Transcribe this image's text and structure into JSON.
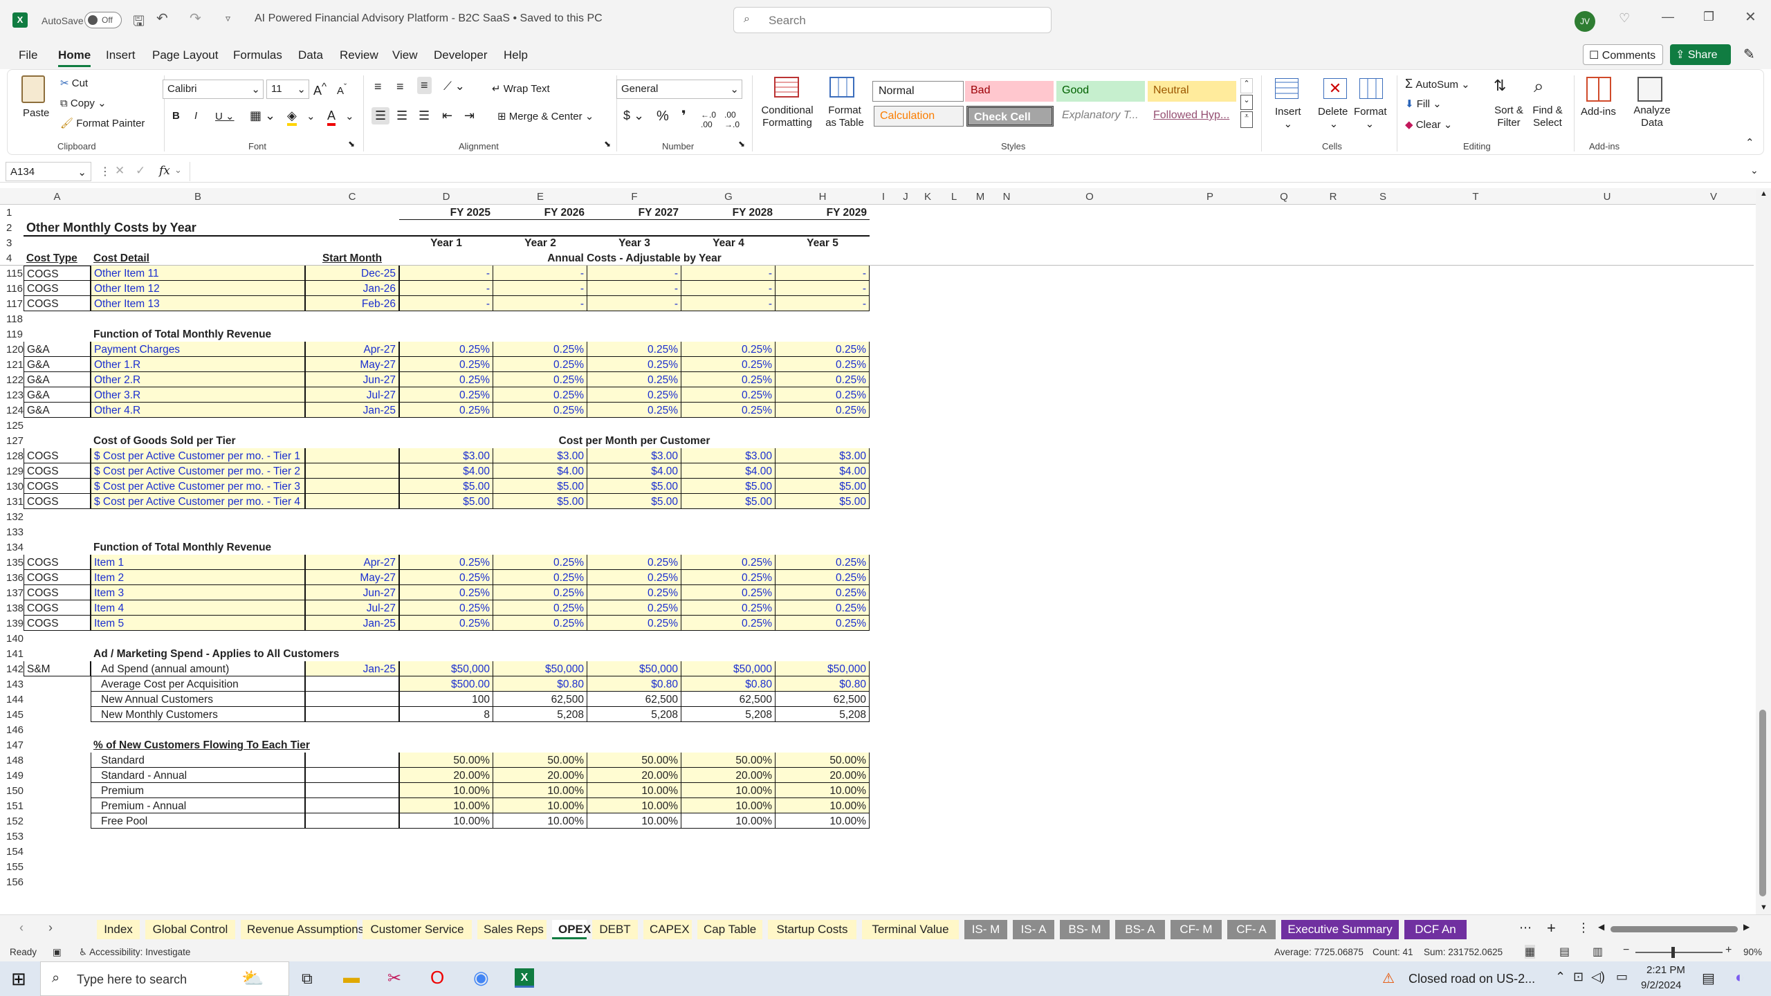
{
  "titlebar": {
    "autosave": "AutoSave",
    "autosave_state": "Off",
    "doc_title": "AI Powered Financial Advisory Platform - B2C SaaS • Saved to this PC",
    "search_placeholder": "Search",
    "user_initials": "JV"
  },
  "menu": [
    "File",
    "Home",
    "Insert",
    "Page Layout",
    "Formulas",
    "Data",
    "Review",
    "View",
    "Developer",
    "Help"
  ],
  "menu_right": {
    "comments": "Comments",
    "share": "Share"
  },
  "ribbon": {
    "clipboard": {
      "paste": "Paste",
      "cut": "Cut",
      "copy": "Copy",
      "format_painter": "Format Painter",
      "group": "Clipboard"
    },
    "font": {
      "name": "Calibri",
      "size": "11",
      "group": "Font"
    },
    "alignment": {
      "wrap": "Wrap Text",
      "merge": "Merge & Center",
      "group": "Alignment"
    },
    "number": {
      "format": "General",
      "group": "Number"
    },
    "styles": {
      "conditional": "Conditional Formatting",
      "format_table": "Format as Table",
      "normal": "Normal",
      "bad": "Bad",
      "good": "Good",
      "neutral": "Neutral",
      "calculation": "Calculation",
      "check_cell": "Check Cell",
      "explanatory": "Explanatory T...",
      "followed": "Followed Hyp...",
      "group": "Styles"
    },
    "cells": {
      "insert": "Insert",
      "delete": "Delete",
      "format": "Format",
      "group": "Cells"
    },
    "editing": {
      "autosum": "AutoSum",
      "fill": "Fill",
      "clear": "Clear",
      "sort": "Sort & Filter",
      "find": "Find & Select",
      "group": "Editing"
    },
    "addins": {
      "addins": "Add-ins",
      "analyze": "Analyze Data",
      "group": "Add-ins"
    }
  },
  "formula_bar": {
    "name_box": "A134",
    "fx": "fx",
    "formula": ""
  },
  "columns": [
    "A",
    "B",
    "C",
    "D",
    "E",
    "F",
    "G",
    "H",
    "I",
    "J",
    "K",
    "L",
    "M",
    "N",
    "O",
    "P",
    "Q",
    "R",
    "S",
    "T",
    "U",
    "V"
  ],
  "header_rows": [
    {
      "n": "1",
      "cells": {
        "D": "FY 2025",
        "E": "FY 2026",
        "F": "FY 2027",
        "G": "FY 2028",
        "H": "FY 2029"
      }
    },
    {
      "n": "2",
      "title": "Other Monthly Costs by Year"
    },
    {
      "n": "3",
      "cells": {
        "D": "Year 1",
        "E": "Year 2",
        "F": "Year 3",
        "G": "Year 4",
        "H": "Year 5"
      }
    },
    {
      "n": "4",
      "cells": {
        "A": "Cost Type",
        "B": "Cost Detail",
        "C": "Start Month",
        "DH": "Annual Costs - Adjustable by Year"
      }
    }
  ],
  "rows": [
    {
      "n": "115",
      "A": "COGS",
      "B": "Other Item 11",
      "C": "Dec-25",
      "v": [
        "-",
        "-",
        "-",
        "-",
        "-"
      ],
      "style": "dash"
    },
    {
      "n": "116",
      "A": "COGS",
      "B": "Other Item 12",
      "C": "Jan-26",
      "v": [
        "-",
        "-",
        "-",
        "-",
        "-"
      ],
      "style": "dash"
    },
    {
      "n": "117",
      "A": "COGS",
      "B": "Other Item 13",
      "C": "Feb-26",
      "v": [
        "-",
        "-",
        "-",
        "-",
        "-"
      ],
      "style": "dash"
    },
    {
      "n": "118"
    },
    {
      "n": "119",
      "hdr": "Function of Total Monthly Revenue"
    },
    {
      "n": "120",
      "A": "G&A",
      "B": "Payment Charges",
      "C": "Apr-27",
      "v": [
        "0.25%",
        "0.25%",
        "0.25%",
        "0.25%",
        "0.25%"
      ],
      "style": "yb"
    },
    {
      "n": "121",
      "A": "G&A",
      "B": "Other 1.R",
      "C": "May-27",
      "v": [
        "0.25%",
        "0.25%",
        "0.25%",
        "0.25%",
        "0.25%"
      ],
      "style": "yb"
    },
    {
      "n": "122",
      "A": "G&A",
      "B": "Other 2.R",
      "C": "Jun-27",
      "v": [
        "0.25%",
        "0.25%",
        "0.25%",
        "0.25%",
        "0.25%"
      ],
      "style": "yb"
    },
    {
      "n": "123",
      "A": "G&A",
      "B": "Other 3.R",
      "C": "Jul-27",
      "v": [
        "0.25%",
        "0.25%",
        "0.25%",
        "0.25%",
        "0.25%"
      ],
      "style": "yb"
    },
    {
      "n": "124",
      "A": "G&A",
      "B": "Other 4.R",
      "C": "Jan-25",
      "v": [
        "0.25%",
        "0.25%",
        "0.25%",
        "0.25%",
        "0.25%"
      ],
      "style": "yb"
    },
    {
      "n": "125"
    },
    {
      "n": "127",
      "hdr": "Cost of Goods Sold per Tier",
      "hdr2": "Cost per Month per Customer"
    },
    {
      "n": "128",
      "A": "COGS",
      "B": "$ Cost per Active Customer per mo. - Tier 1",
      "v": [
        "$3.00",
        "$3.00",
        "$3.00",
        "$3.00",
        "$3.00"
      ],
      "style": "yb"
    },
    {
      "n": "129",
      "A": "COGS",
      "B": "$ Cost per Active Customer per mo. - Tier 2",
      "v": [
        "$4.00",
        "$4.00",
        "$4.00",
        "$4.00",
        "$4.00"
      ],
      "style": "yb"
    },
    {
      "n": "130",
      "A": "COGS",
      "B": "$ Cost per Active Customer per mo. - Tier 3",
      "v": [
        "$5.00",
        "$5.00",
        "$5.00",
        "$5.00",
        "$5.00"
      ],
      "style": "yb"
    },
    {
      "n": "131",
      "A": "COGS",
      "B": "$ Cost per Active Customer per mo. - Tier 4",
      "v": [
        "$5.00",
        "$5.00",
        "$5.00",
        "$5.00",
        "$5.00"
      ],
      "style": "yb"
    },
    {
      "n": "132"
    },
    {
      "n": "133"
    },
    {
      "n": "134",
      "hdr": "Function of Total Monthly Revenue"
    },
    {
      "n": "135",
      "A": "COGS",
      "B": "Item 1",
      "C": "Apr-27",
      "v": [
        "0.25%",
        "0.25%",
        "0.25%",
        "0.25%",
        "0.25%"
      ],
      "style": "yb"
    },
    {
      "n": "136",
      "A": "COGS",
      "B": "Item 2",
      "C": "May-27",
      "v": [
        "0.25%",
        "0.25%",
        "0.25%",
        "0.25%",
        "0.25%"
      ],
      "style": "yb"
    },
    {
      "n": "137",
      "A": "COGS",
      "B": "Item 3",
      "C": "Jun-27",
      "v": [
        "0.25%",
        "0.25%",
        "0.25%",
        "0.25%",
        "0.25%"
      ],
      "style": "yb"
    },
    {
      "n": "138",
      "A": "COGS",
      "B": "Item 4",
      "C": "Jul-27",
      "v": [
        "0.25%",
        "0.25%",
        "0.25%",
        "0.25%",
        "0.25%"
      ],
      "style": "yb"
    },
    {
      "n": "139",
      "A": "COGS",
      "B": "Item 5",
      "C": "Jan-25",
      "v": [
        "0.25%",
        "0.25%",
        "0.25%",
        "0.25%",
        "0.25%"
      ],
      "style": "yb"
    },
    {
      "n": "140"
    },
    {
      "n": "141",
      "hdr": "Ad / Marketing Spend - Applies to All Customers"
    },
    {
      "n": "142",
      "A": "S&M",
      "B": "Ad Spend (annual amount)",
      "C": "Jan-25",
      "v": [
        "$50,000",
        "$50,000",
        "$50,000",
        "$50,000",
        "$50,000"
      ],
      "style": "yb",
      "bstyle": "plain"
    },
    {
      "n": "143",
      "B": "Average Cost per Acquisition",
      "v": [
        "$500.00",
        "$0.80",
        "$0.80",
        "$0.80",
        "$0.80"
      ],
      "style": "yb",
      "bstyle": "plain",
      "cplain": true
    },
    {
      "n": "144",
      "B": "New Annual Customers",
      "v": [
        "100",
        "62,500",
        "62,500",
        "62,500",
        "62,500"
      ],
      "style": "plain",
      "bstyle": "plain",
      "cplain": true
    },
    {
      "n": "145",
      "B": "New Monthly Customers",
      "v": [
        "8",
        "5,208",
        "5,208",
        "5,208",
        "5,208"
      ],
      "style": "plain",
      "bstyle": "plain",
      "cplain": true
    },
    {
      "n": "146"
    },
    {
      "n": "147",
      "hdr": "% of New Customers Flowing To Each Tier",
      "underline": true
    },
    {
      "n": "148",
      "B": "Standard",
      "v": [
        "50.00%",
        "50.00%",
        "50.00%",
        "50.00%",
        "50.00%"
      ],
      "style": "yk",
      "bstyle": "plain",
      "cplain": true
    },
    {
      "n": "149",
      "B": "Standard - Annual",
      "v": [
        "20.00%",
        "20.00%",
        "20.00%",
        "20.00%",
        "20.00%"
      ],
      "style": "yk",
      "bstyle": "plain",
      "cplain": true
    },
    {
      "n": "150",
      "B": "Premium",
      "v": [
        "10.00%",
        "10.00%",
        "10.00%",
        "10.00%",
        "10.00%"
      ],
      "style": "yk",
      "bstyle": "plain",
      "cplain": true
    },
    {
      "n": "151",
      "B": "Premium - Annual",
      "v": [
        "10.00%",
        "10.00%",
        "10.00%",
        "10.00%",
        "10.00%"
      ],
      "style": "yk",
      "bstyle": "plain",
      "cplain": true
    },
    {
      "n": "152",
      "B": "Free Pool",
      "v": [
        "10.00%",
        "10.00%",
        "10.00%",
        "10.00%",
        "10.00%"
      ],
      "style": "plain",
      "bstyle": "plain",
      "cplain": true
    },
    {
      "n": "153"
    },
    {
      "n": "154"
    },
    {
      "n": "155"
    },
    {
      "n": "156"
    }
  ],
  "sheet_tabs": [
    {
      "label": "Index",
      "color": "#fff7c8"
    },
    {
      "label": "Global Control",
      "color": "#fff7c8"
    },
    {
      "label": "Revenue Assumptions",
      "color": "#fff7c8"
    },
    {
      "label": "Customer Service",
      "color": "#fff7c8"
    },
    {
      "label": "Sales Reps",
      "color": "#fff7c8"
    },
    {
      "label": "OPEX",
      "color": "#ffffff",
      "active": true
    },
    {
      "label": "DEBT",
      "color": "#fff7c8"
    },
    {
      "label": "CAPEX",
      "color": "#fff7c8"
    },
    {
      "label": "Cap Table",
      "color": "#fff7c8"
    },
    {
      "label": "Startup Costs",
      "color": "#fff7c8"
    },
    {
      "label": "Terminal Value",
      "color": "#fff7c8"
    },
    {
      "label": "IS- M",
      "color": "#8c8c8c"
    },
    {
      "label": "IS- A",
      "color": "#8c8c8c"
    },
    {
      "label": "BS- M",
      "color": "#8c8c8c"
    },
    {
      "label": "BS- A",
      "color": "#8c8c8c"
    },
    {
      "label": "CF- M",
      "color": "#8c8c8c"
    },
    {
      "label": "CF- A",
      "color": "#8c8c8c"
    },
    {
      "label": "Executive Summary",
      "color": "#7030a0"
    },
    {
      "label": "DCF An",
      "color": "#7030a0"
    }
  ],
  "status": {
    "ready": "Ready",
    "accessibility": "Accessibility: Investigate",
    "average": "Average: 7725.06875",
    "count": "Count: 41",
    "sum": "Sum: 231752.0625",
    "zoom": "90%"
  },
  "taskbar": {
    "search": "Type here to search",
    "news": "Closed road on US-2...",
    "time": "2:21 PM",
    "date": "9/2/2024"
  }
}
